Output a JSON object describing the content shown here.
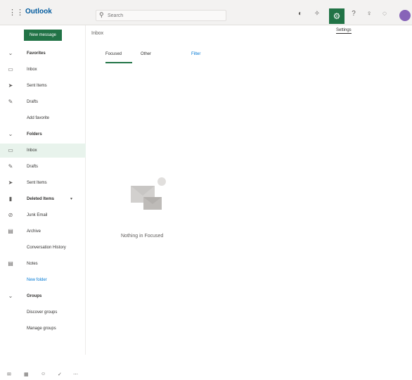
{
  "topbar": {
    "waffle_icon": "waffle-icon",
    "brand": "Outlook",
    "brand_sub": "",
    "search_placeholder": "Search",
    "tooltip": "Settings"
  },
  "sidebar": {
    "new_message": "New message",
    "items": [
      {
        "label": "Favorites",
        "icon": "chevron-down-icon"
      },
      {
        "label": "Inbox",
        "icon": "inbox-icon"
      },
      {
        "label": "Sent Items",
        "icon": "send-icon"
      },
      {
        "label": "Drafts",
        "icon": "pencil-icon"
      },
      {
        "label": "Add favorite",
        "icon": ""
      },
      {
        "label": "Folders",
        "icon": "chevron-down-icon"
      },
      {
        "label": "Inbox",
        "icon": "inbox-icon"
      },
      {
        "label": "Drafts",
        "icon": "pencil-icon"
      },
      {
        "label": "Sent Items",
        "icon": "send-icon"
      },
      {
        "label": "Deleted Items",
        "icon": "trash-icon"
      },
      {
        "label": "Junk Email",
        "icon": "junk-icon"
      },
      {
        "label": "Archive",
        "icon": "archive-icon"
      },
      {
        "label": "Conversation History",
        "icon": ""
      },
      {
        "label": "Notes",
        "icon": "notes-icon"
      },
      {
        "label": "New folder",
        "icon": ""
      },
      {
        "label": "Groups",
        "icon": "chevron-down-icon"
      },
      {
        "label": "Discover groups",
        "icon": ""
      },
      {
        "label": "Manage groups",
        "icon": ""
      }
    ]
  },
  "content": {
    "breadcrumb": "Inbox",
    "tabs": [
      {
        "label": "Focused"
      },
      {
        "label": "Other"
      },
      {
        "label": "Filter"
      }
    ],
    "empty_message": "Nothing in Focused"
  },
  "colors": {
    "accent": "#217346",
    "selected_bg": "#e8f3ec",
    "topbar_bg": "#f3f2f1"
  }
}
